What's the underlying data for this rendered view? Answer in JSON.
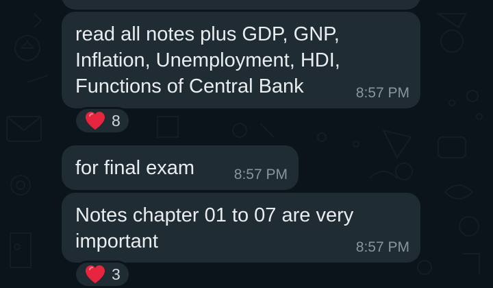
{
  "messages": [
    {
      "text": "read all notes plus GDP, GNP,\nInflation, Unemployment, HDI,\nFunctions of Central Bank",
      "time": "8:57 PM",
      "reaction": {
        "emoji": "heart",
        "count": "8"
      }
    },
    {
      "text": "for final exam",
      "time": "8:57 PM"
    },
    {
      "text": "Notes chapter 01 to 07 are very\nimportant",
      "time": "8:57 PM",
      "reaction": {
        "emoji": "heart",
        "count": "3"
      }
    }
  ],
  "colors": {
    "background": "#0b141a",
    "bubble": "#202c33",
    "text": "#e9edef",
    "timestamp": "#8696a0",
    "heart": "#e8253f"
  }
}
